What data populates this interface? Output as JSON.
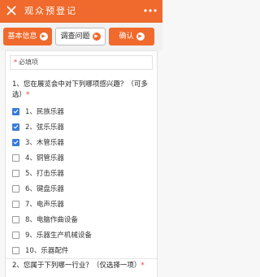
{
  "header": {
    "title": "观众预登记",
    "bg_color": "#ef6a2c"
  },
  "tabs": [
    {
      "label": "基本信息",
      "active": true
    },
    {
      "label": "调查问题",
      "active": false
    },
    {
      "label": "确认",
      "active": true
    }
  ],
  "form": {
    "required_note": "必填项",
    "required_marker": "*",
    "q1": {
      "title": "1、您在展览会中对下列哪项感兴趣？（可多选）",
      "required_marker": "*",
      "options": [
        {
          "label": "1、民族乐器",
          "checked": true
        },
        {
          "label": "2、弦乐乐器",
          "checked": true
        },
        {
          "label": "3、木管乐器",
          "checked": true
        },
        {
          "label": "4、铜管乐器",
          "checked": false
        },
        {
          "label": "5、打击乐器",
          "checked": false
        },
        {
          "label": "6、键盘乐器",
          "checked": false
        },
        {
          "label": "7、电声乐器",
          "checked": false
        },
        {
          "label": "8、电脑作曲设备",
          "checked": false
        },
        {
          "label": "9、乐器生产机械设备",
          "checked": false
        },
        {
          "label": "10、乐器配件",
          "checked": false
        }
      ]
    },
    "q2": {
      "title": "2、您属于下列哪一行业？（仅选择一项）",
      "required_marker": "*"
    }
  },
  "colors": {
    "accent": "#ef6a2c",
    "check": "#3a7bd5"
  },
  "icons": {
    "close": "close-icon",
    "more": "more-icon",
    "arrow": "arrow-right-icon"
  }
}
